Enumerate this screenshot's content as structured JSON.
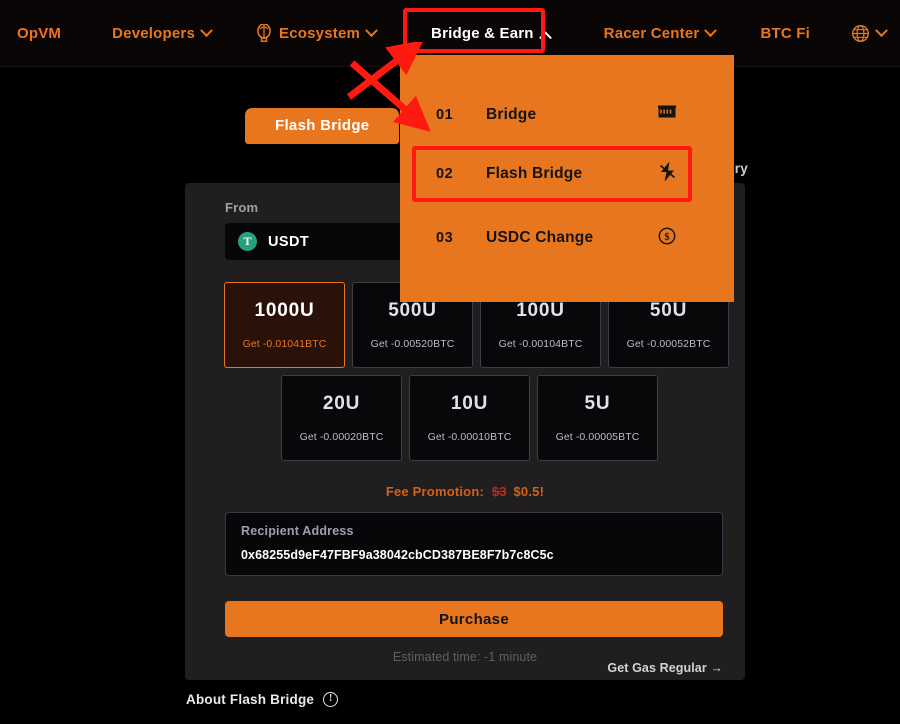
{
  "navbar": {
    "brand": "OpVM",
    "items": [
      {
        "label": "Developers",
        "icon": "chevron-down-icon",
        "has_chevron": true,
        "active": false
      },
      {
        "label": "Ecosystem",
        "icon": "balloon-icon",
        "has_chevron": true,
        "active": false
      },
      {
        "label": "Bridge & Earn",
        "icon": "chevron-up-icon",
        "has_chevron": true,
        "active": true
      },
      {
        "label": "Racer Center",
        "icon": "chevron-down-icon",
        "has_chevron": true,
        "active": false
      },
      {
        "label": "BTC Fi",
        "icon": "",
        "has_chevron": false,
        "active": false
      }
    ],
    "language": {
      "icon": "globe-icon",
      "chevron": "chevron-down-icon"
    }
  },
  "dropdown": {
    "items": [
      {
        "number": "01",
        "label": "Bridge",
        "icon": "bridge-icon",
        "highlighted": false
      },
      {
        "number": "02",
        "label": "Flash Bridge",
        "icon": "lightning-bolt-icon",
        "highlighted": true
      },
      {
        "number": "03",
        "label": "USDC Change",
        "icon": "dollar-circle-icon",
        "highlighted": false
      }
    ]
  },
  "tab": {
    "label": "Flash Bridge"
  },
  "history": {
    "label": "History"
  },
  "form": {
    "from_label": "From",
    "token": {
      "symbol": "USDT",
      "badge": "T"
    },
    "amount_tiles_row1": [
      {
        "amount": "1000U",
        "get": "Get -0.01041BTC",
        "selected": true
      },
      {
        "amount": "500U",
        "get": "Get -0.00520BTC",
        "selected": false
      },
      {
        "amount": "100U",
        "get": "Get -0.00104BTC",
        "selected": false
      },
      {
        "amount": "50U",
        "get": "Get -0.00052BTC",
        "selected": false
      }
    ],
    "amount_tiles_row2": [
      {
        "amount": "20U",
        "get": "Get -0.00020BTC",
        "selected": false
      },
      {
        "amount": "10U",
        "get": "Get -0.00010BTC",
        "selected": false
      },
      {
        "amount": "5U",
        "get": "Get -0.00005BTC",
        "selected": false
      }
    ],
    "fee_promotion": {
      "label": "Fee Promotion:",
      "old_price": "$3",
      "new_price": "$0.5!"
    },
    "recipient": {
      "label": "Recipient Address",
      "value": "0x68255d9eF47FBF9a38042cbCD387BE8F7b7c8C5c"
    },
    "purchase_button": "Purchase",
    "estimated_time": "Estimated time: -1 minute",
    "get_gas": "Get Gas Regular →"
  },
  "footer": {
    "about_label": "About Flash Bridge",
    "info_icon": "info-circle-icon"
  },
  "colors": {
    "accent_orange": "#E8761F",
    "page_background": "#000000",
    "card_background": "#201E1E",
    "annotation_red": "#FF1A11",
    "tile_selected_bg": "#2A1209",
    "fee_old_red": "#C2281A",
    "usdt_green": "#26A17B"
  }
}
